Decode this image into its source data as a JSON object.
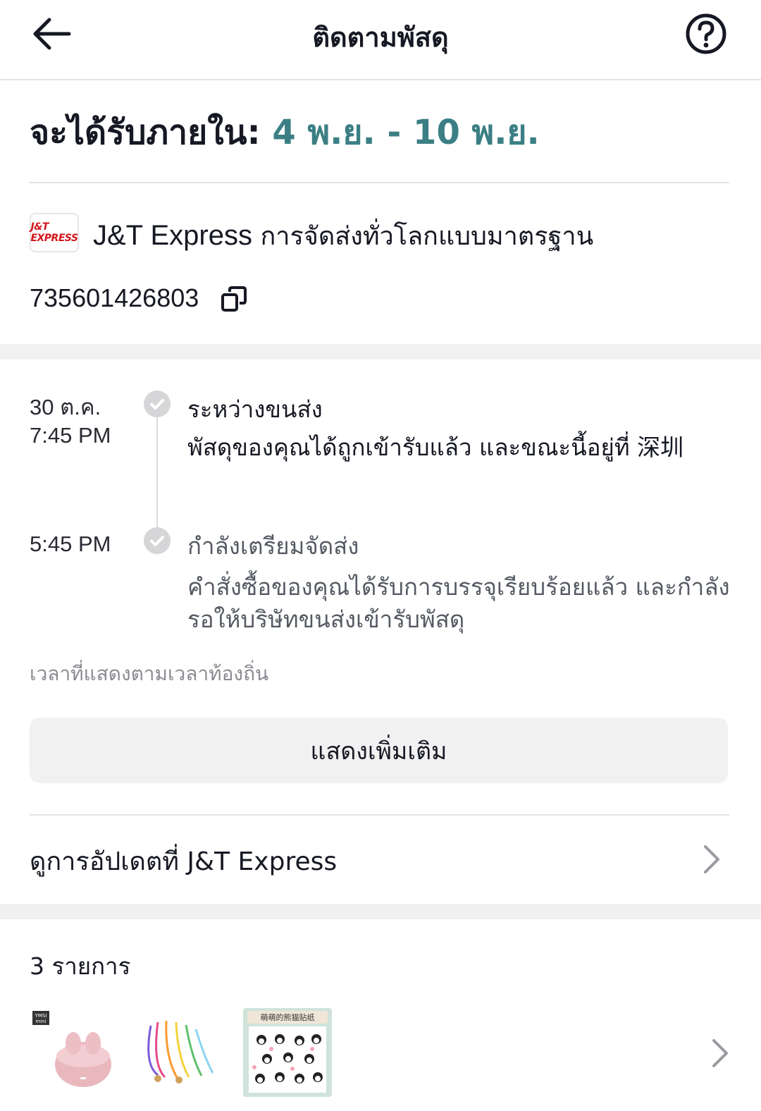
{
  "header": {
    "title": "ติดตามพัสดุ",
    "back_icon": "arrow-left-icon",
    "help_icon": "question-circle-icon"
  },
  "delivery": {
    "label": "จะได้รับภายใน:",
    "range": "4 พ.ย. - 10 พ.ย."
  },
  "carrier": {
    "logo_text": "J&T EXPRESS",
    "name": "J&T Express",
    "service": "การจัดส่งทั่วโลกแบบมาตรฐาน",
    "tracking_number": "735601426803",
    "copy_icon": "copy-icon"
  },
  "timeline": [
    {
      "date": "30 ต.ค.",
      "time": "7:45 PM",
      "title": "ระหว่างขนส่ง",
      "description": "พัสดุของคุณได้ถูกเข้ารับแล้ว และขณะนี้อยู่ที่ 深圳"
    },
    {
      "date": "",
      "time": "5:45 PM",
      "title": "กำลังเตรียมจัดส่ง",
      "description": "คำสั่งซื้อของคุณได้รับการบรรจุเรียบร้อยแล้ว และกำลังรอให้บริษัทขนส่งเข้ารับพัสดุ"
    }
  ],
  "timezone_note": "เวลาที่แสดงตามเวลาท้องถิ่น",
  "show_more_label": "แสดงเพิ่มเติม",
  "update_link_label": "ดูการอัปเดตที่ J&T Express",
  "items": {
    "count_label": "3 รายการ",
    "thumbnails": [
      "pink-earbuds-case",
      "colorful-phone-lanyards",
      "panda-sticker-sheet"
    ],
    "thumbnail_badge": "YMSI mini",
    "sticker_caption": "萌萌的熊猫贴纸"
  },
  "colors": {
    "accent": "#3b7f84",
    "text": "#161823",
    "muted": "#8a8b91",
    "divider": "#e3e3e4",
    "band": "#f1f1f2",
    "logo_red": "#d3151c"
  }
}
